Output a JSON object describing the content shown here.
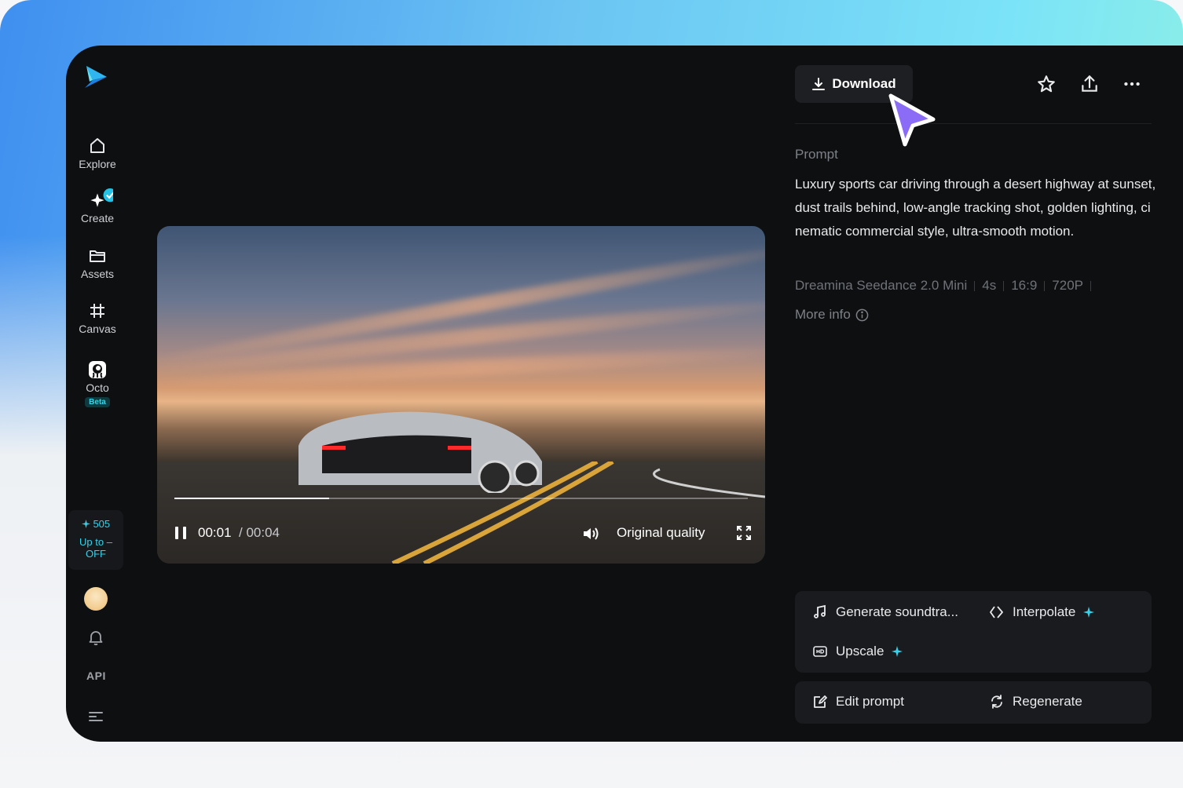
{
  "sidebar": {
    "items": [
      {
        "label": "Explore"
      },
      {
        "label": "Create"
      },
      {
        "label": "Assets"
      },
      {
        "label": "Canvas"
      },
      {
        "label": "Octo",
        "badge": "Beta"
      }
    ],
    "credits": {
      "count": "505",
      "promo": "Up to –\nOFF"
    },
    "api_label": "API"
  },
  "video": {
    "current_time": "00:01",
    "total_time": "/ 00:04",
    "progress": 0.27,
    "quality_label": "Original quality"
  },
  "panel": {
    "download_label": "Download",
    "prompt_label": "Prompt",
    "prompt_text": "Luxury sports car driving through a desert highway at sunset, dust trails behind, low-angle tracking shot, golden lighting, cinematic commercial style, ultra-smooth motion.",
    "meta": [
      "Dreamina Seedance 2.0 Mini",
      "4s",
      "16:9",
      "720P"
    ],
    "more_info_label": "More info",
    "tools": {
      "soundtrack": "Generate soundtra...",
      "interpolate": "Interpolate",
      "upscale": "Upscale",
      "edit_prompt": "Edit prompt",
      "regenerate": "Regenerate"
    }
  },
  "colors": {
    "accent": "#36d1ea",
    "cursor": "#8b6cf6",
    "app_bg": "#0e0f11"
  }
}
